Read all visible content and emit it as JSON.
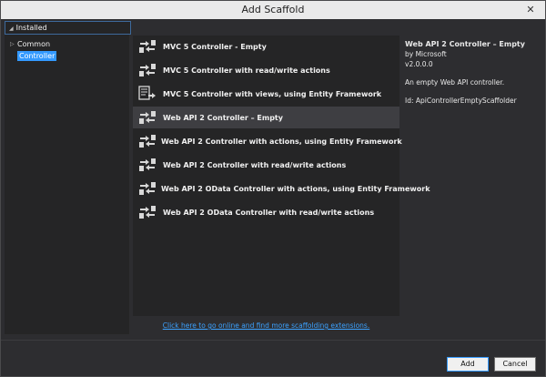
{
  "window": {
    "title": "Add Scaffold"
  },
  "left": {
    "installed_label": "Installed",
    "tree": [
      {
        "label": "Common",
        "selected": false
      },
      {
        "label": "Controller",
        "selected": true
      }
    ]
  },
  "items": [
    {
      "label": "MVC 5 Controller - Empty",
      "icon": "controller-icon"
    },
    {
      "label": "MVC 5 Controller with read/write actions",
      "icon": "controller-icon"
    },
    {
      "label": "MVC 5 Controller with views, using Entity Framework",
      "icon": "controller-views-icon"
    },
    {
      "label": "Web API 2 Controller – Empty",
      "icon": "controller-icon"
    },
    {
      "label": "Web API 2 Controller with actions, using Entity Framework",
      "icon": "controller-icon"
    },
    {
      "label": "Web API 2 Controller with read/write actions",
      "icon": "controller-icon"
    },
    {
      "label": "Web API 2 OData Controller with actions, using Entity Framework",
      "icon": "controller-icon"
    },
    {
      "label": "Web API 2 OData Controller with read/write actions",
      "icon": "controller-icon"
    }
  ],
  "selected_index": 3,
  "details": {
    "title": "Web API 2 Controller – Empty",
    "author": "by Microsoft",
    "version": "v2.0.0.0",
    "description": "An empty Web API controller.",
    "id": "Id: ApiControllerEmptyScaffolder"
  },
  "link": "Click here to go online and find more scaffolding extensions.",
  "buttons": {
    "add": "Add",
    "cancel": "Cancel"
  },
  "colors": {
    "accent": "#3399ff",
    "link": "#3ca2ff",
    "selected_row": "#3e3e42"
  }
}
